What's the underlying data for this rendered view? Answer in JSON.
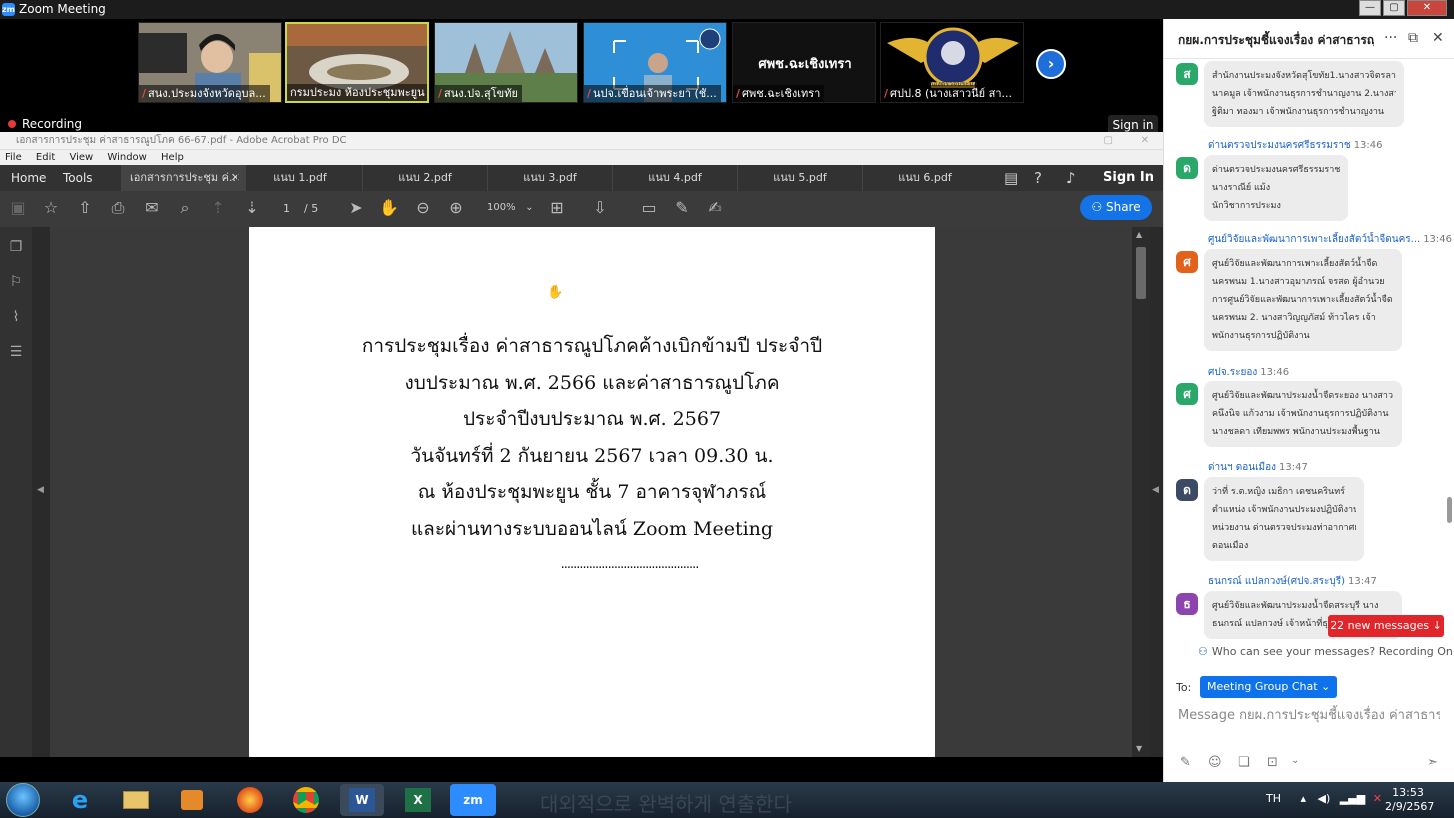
{
  "titlebar": {
    "app_icon": "zm",
    "title": "Zoom Meeting"
  },
  "video_strip": {
    "tiles": [
      {
        "name": "สนง.ประมงจังหวัดอุบล...",
        "bg": "#7a7060"
      },
      {
        "name": "กรมประมง ห้องประชุมพะยูน",
        "bg": "#6e5a44"
      },
      {
        "name": "สนง.ปจ.สุโขทัย",
        "bg": "#6f8a66"
      },
      {
        "name": "นปจ.เขื่อนเจ้าพระยา (ชั...",
        "bg": "#2f8fd6"
      },
      {
        "name": "ศพช.ฉะเชิงเทรา",
        "bg": "#111111",
        "center_text": "ศพช.ฉะเชิงเทรา"
      },
      {
        "name": "ศปป.8 (นางเสาวนีย์ สา...",
        "bg": "#1f2d6e",
        "logo_text": "กองตรวจประมง"
      }
    ],
    "recording_label": "Recording",
    "signin_label": "Sign in"
  },
  "acrobat": {
    "window_title": "เอกสารการประชุม ค่าสาธารณูปโภค 66-67.pdf - Adobe Acrobat Pro DC",
    "menu": [
      "File",
      "Edit",
      "View",
      "Window",
      "Help"
    ],
    "home": "Home",
    "tools": "Tools",
    "tabs": [
      "เอกสารการประชุม ค่...",
      "แนบ 1.pdf",
      "แนบ 2.pdf",
      "แนบ 3.pdf",
      "แนบ 4.pdf",
      "แนบ 5.pdf",
      "แนบ 6.pdf"
    ],
    "signin": "Sign In",
    "page_current": "1",
    "page_total": "/ 5",
    "zoom": "100%",
    "share": "Share",
    "doc_lines": [
      "การประชุมเรื่อง ค่าสาธารณูปโภคค้างเบิกข้ามปี ประจำปี",
      "งบประมาณ พ.ศ. 2566 และค่าสาธารณูปโภค",
      "ประจำปีงบประมาณ พ.ศ. 2567",
      "วันจันทร์ที่ 2 กันยายน 2567 เวลา 09.30 น.",
      "ณ ห้องประชุมพะยูน ชั้น 7 อาคารจุฬาภรณ์",
      "และผ่านทางระบบออนไลน์ Zoom Meeting"
    ],
    "doc_dots": "............................................"
  },
  "chat": {
    "title": "กยผ.การประชุมชี้แจงเรื่อง ค่าสาธารณู...",
    "messages": [
      {
        "avatar": "ส",
        "color": "#2aa86a",
        "sender": "",
        "time": "",
        "lines": [
          "สำนักงานประมงจังหวัดสุโขทัย1.นางสาวจิตรลา",
          "นาคมูล เจ้าพนักงานธุรการชำนาญงาน 2.นางสาว",
          "ฐิติมา ทองมา เจ้าพนักงานธุรการชำนาญงาน"
        ]
      },
      {
        "avatar": "ด",
        "color": "#2aa86a",
        "sender": "ด่านตรวจประมงนครศรีธรรมราช",
        "time": "13:46",
        "lines": [
          "ด่านตรวจประมงนครศรีธรรมราช",
          "นางราณีย์ แม้ง",
          "นักวิชาการประมง"
        ]
      },
      {
        "avatar": "ศ",
        "color": "#e2621b",
        "sender": "ศูนย์วิจัยและพัฒนาการเพาะเลี้ยงสัตว์น้ำจืดนคร...",
        "time": "13:46",
        "lines": [
          "ศูนย์วิจัยและพัฒนาการเพาะเลี้ยงสัตว์น้ำจืด",
          "นครพนม 1.นางสาวอุมาภรณ์ จรสด ผู้อำนวย",
          "การศูนย์วิจัยและพัฒนาการเพาะเลี้ยงสัตว์น้ำจืด",
          "นครพนม 2. นางสาวิญญภัสม์ ท้าวไคร เจ้า",
          "พนักงานธุรการปฏิบัติงาน"
        ]
      },
      {
        "avatar": "ศ",
        "color": "#2aa86a",
        "sender": "ศปจ.ระยอง",
        "time": "13:46",
        "lines": [
          "ศูนย์วิจัยและพัฒนาประมงน้ำจืดระยอง นางสาว",
          "คนึงนิจ แก้วงาม เจ้าพนักงานธุรการปฏิบัติงาน",
          "นางชลดา เทียมพพร พนักงานประมงพื้นฐาน"
        ]
      },
      {
        "avatar": "ด",
        "color": "#3c4a63",
        "sender": "ด่านฯ ดอนเมือง",
        "time": "13:47",
        "lines": [
          "ว่าที่ ร.ต.หญิง เมธิกา เดชนครินทร์",
          "ตำแหน่ง เจ้าพนักงานประมงปฏิบัติงาน",
          "หน่วยงาน ด่านตรวจประมงท่าอากาศยาน",
          "ดอนเมือง"
        ]
      },
      {
        "avatar": "ธ",
        "color": "#8e44ad",
        "sender": "ธนกรณ์ แปลกวงษ์(ศปจ.สระบุรี)",
        "time": "13:47",
        "lines": [
          "ศูนย์วิจัยและพัฒนาประมงน้ำจืดสระบุรี นาง",
          "ธนกรณ์ แปลกวงษ์ เจ้าหน้าที่ธุร"
        ]
      }
    ],
    "new_messages": "22 new messages ↓",
    "who_can_see": "Who can see your messages? Recording On",
    "to_label": "To:",
    "to_target": "Meeting Group Chat ⌄",
    "input_placeholder": "Message กยผ.การประชุมชี้แจงเรื่อง ค่าสาธารณูป..."
  },
  "taskbar": {
    "ghost_text": "대외적으로 완벽하게 연출한다",
    "lang": "TH",
    "time": "13:53",
    "date": "2/9/2567"
  }
}
